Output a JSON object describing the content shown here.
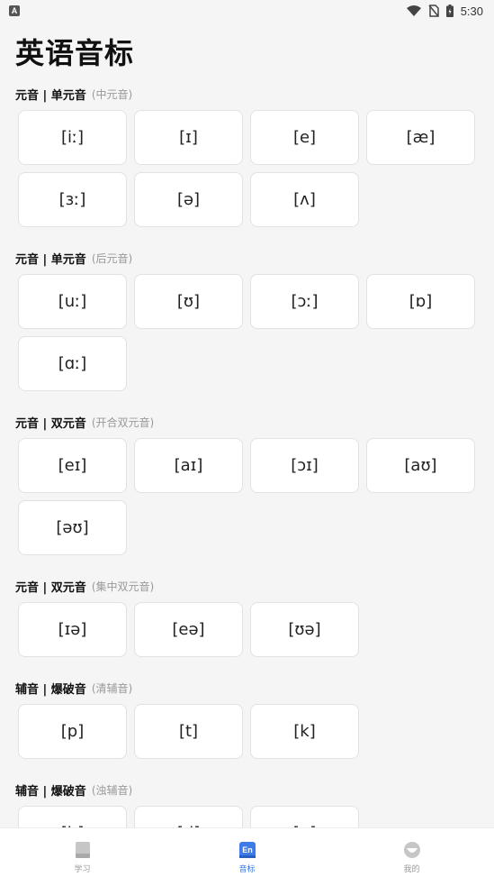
{
  "status_bar": {
    "notification_badge": "A",
    "time": "5:30"
  },
  "page_title": "英语音标",
  "sections": [
    {
      "title": "元音 | 单元音",
      "subtitle": "(中元音)",
      "symbols": [
        "[iː]",
        "[ɪ]",
        "[e]",
        "[æ]",
        "[ɜː]",
        "[ə]",
        "[ʌ]"
      ]
    },
    {
      "title": "元音 | 单元音",
      "subtitle": "(后元音)",
      "symbols": [
        "[uː]",
        "[ʊ]",
        "[ɔː]",
        "[ɒ]",
        "[ɑː]"
      ]
    },
    {
      "title": "元音 | 双元音",
      "subtitle": "(开合双元音)",
      "symbols": [
        "[eɪ]",
        "[aɪ]",
        "[ɔɪ]",
        "[aʊ]",
        "[əʊ]"
      ]
    },
    {
      "title": "元音 | 双元音",
      "subtitle": "(集中双元音)",
      "symbols": [
        "[ɪə]",
        "[eə]",
        "[ʊə]"
      ]
    },
    {
      "title": "辅音 | 爆破音",
      "subtitle": "(清辅音)",
      "symbols": [
        "[p]",
        "[t]",
        "[k]"
      ]
    },
    {
      "title": "辅音 | 爆破音",
      "subtitle": "(浊辅音)",
      "symbols": [
        "[b]",
        "[d]",
        "[g]"
      ]
    }
  ],
  "bottom_nav": {
    "items": [
      {
        "label": "学习",
        "icon": "book-icon",
        "active": false
      },
      {
        "label": "音标",
        "icon": "en-icon",
        "active": true,
        "icon_text": "En"
      },
      {
        "label": "我的",
        "icon": "profile-icon",
        "active": false
      }
    ]
  },
  "colors": {
    "accent": "#3d7be8",
    "inactive": "#bfbfbf",
    "background": "#f5f5f5"
  }
}
